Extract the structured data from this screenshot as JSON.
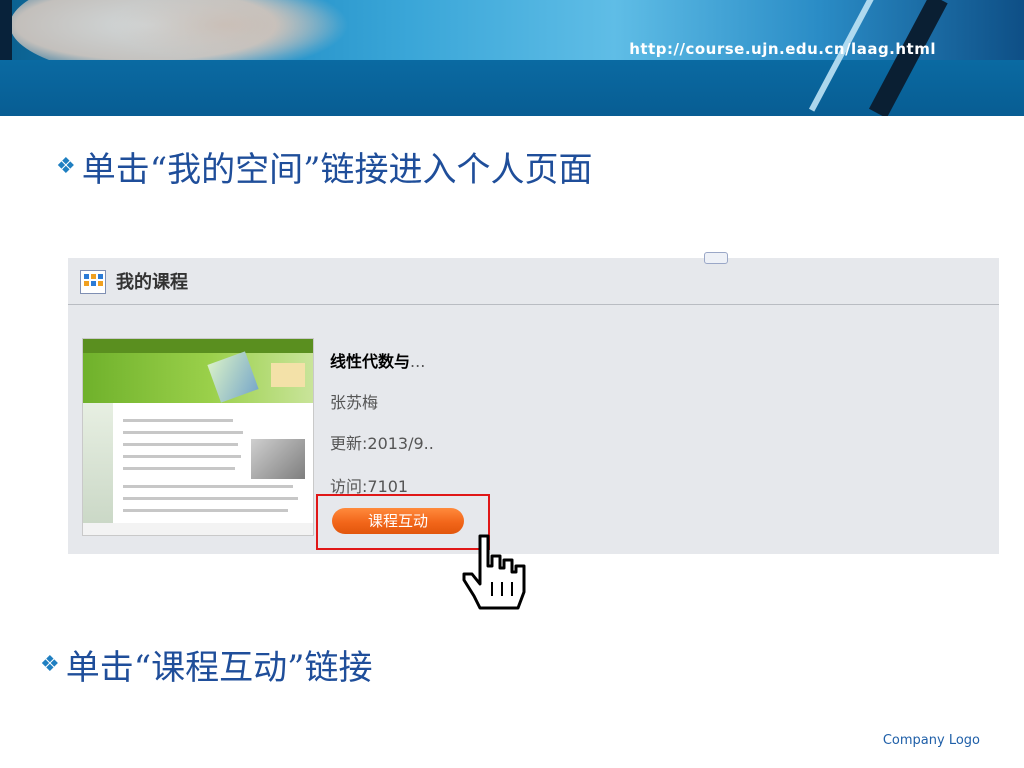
{
  "header": {
    "url": "http://course.ujn.edu.cn/laag.html"
  },
  "bullets": [
    {
      "mark": "❖",
      "text": "单击“我的空间”链接进入个人页面"
    },
    {
      "mark": "❖",
      "text": "单击“课程互动”链接"
    }
  ],
  "panel": {
    "title": "我的课程",
    "course": {
      "name": "线性代数与",
      "ellipsis": "...",
      "teacher": "张苏梅",
      "updated": "更新:2013/9..",
      "visits": "访问:7101",
      "action_label": "课程互动"
    }
  },
  "footer": {
    "logo_text": "Company Logo"
  },
  "colors": {
    "header_blue": "#085d93",
    "bullet_text": "#1f4e9a",
    "highlight_red": "#e01717",
    "button_orange": "#f2661a"
  }
}
